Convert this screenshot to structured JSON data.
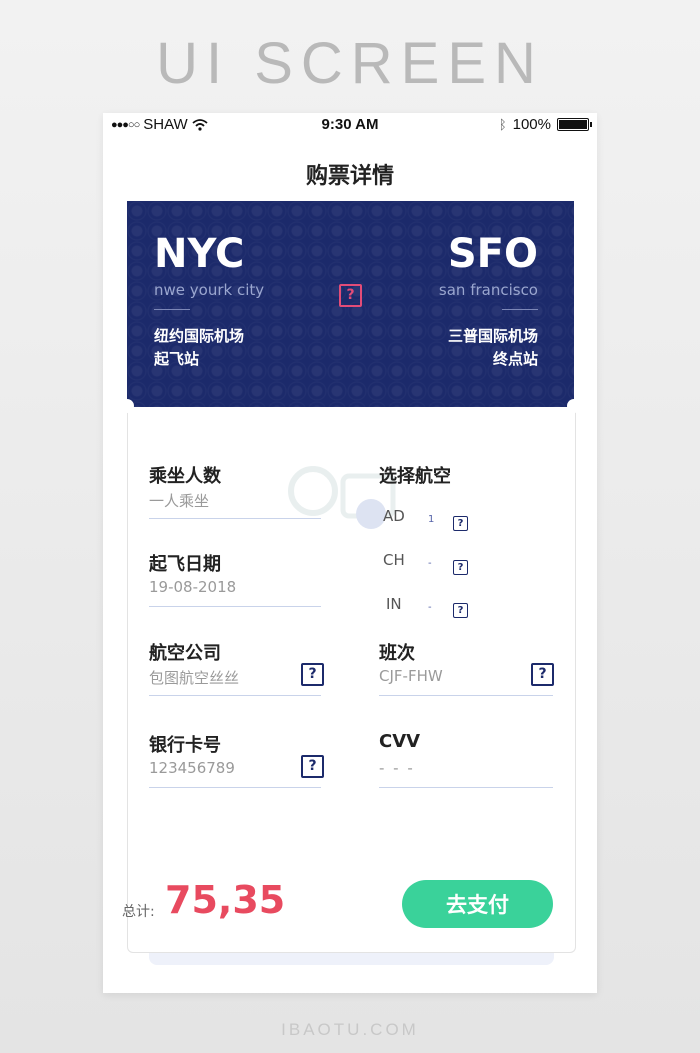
{
  "poster": {
    "title": "UI SCREEN",
    "footer": "IBAOTU.COM"
  },
  "status_bar": {
    "carrier": "SHAW",
    "time": "9:30 AM",
    "battery": "100%"
  },
  "page": {
    "title": "购票详情"
  },
  "flight": {
    "origin": {
      "code": "NYC",
      "city": "nwe yourk city",
      "airport": "纽约国际机场",
      "role": "起飞站"
    },
    "destination": {
      "code": "SFO",
      "city": "san francisco",
      "airport": "三普国际机场",
      "role": "终点站"
    },
    "info_icon": "question-box-icon"
  },
  "form": {
    "passengers": {
      "label": "乘坐人数",
      "value": "一人乘坐"
    },
    "airline_select": {
      "label": "选择航空",
      "options": [
        {
          "code": "AD",
          "count": "1"
        },
        {
          "code": "CH",
          "count": "-"
        },
        {
          "code": "IN",
          "count": "-"
        }
      ]
    },
    "departure_date": {
      "label": "起飞日期",
      "value": "19-08-2018"
    },
    "airline_company": {
      "label": "航空公司",
      "value": "包图航空丝丝"
    },
    "flight_no": {
      "label": "班次",
      "value": "CJF-FHW"
    },
    "bank_card": {
      "label": "银行卡号",
      "value": "123456789"
    },
    "cvv": {
      "label": "CVV",
      "value": "- - -"
    }
  },
  "summary": {
    "total_label": "总计:",
    "total_value": "75,35",
    "pay_button": "去支付"
  },
  "colors": {
    "navy": "#1c2a6b",
    "accent_pink": "#e34c78",
    "total_red": "#e84a5f",
    "pay_green": "#3ad29a"
  }
}
